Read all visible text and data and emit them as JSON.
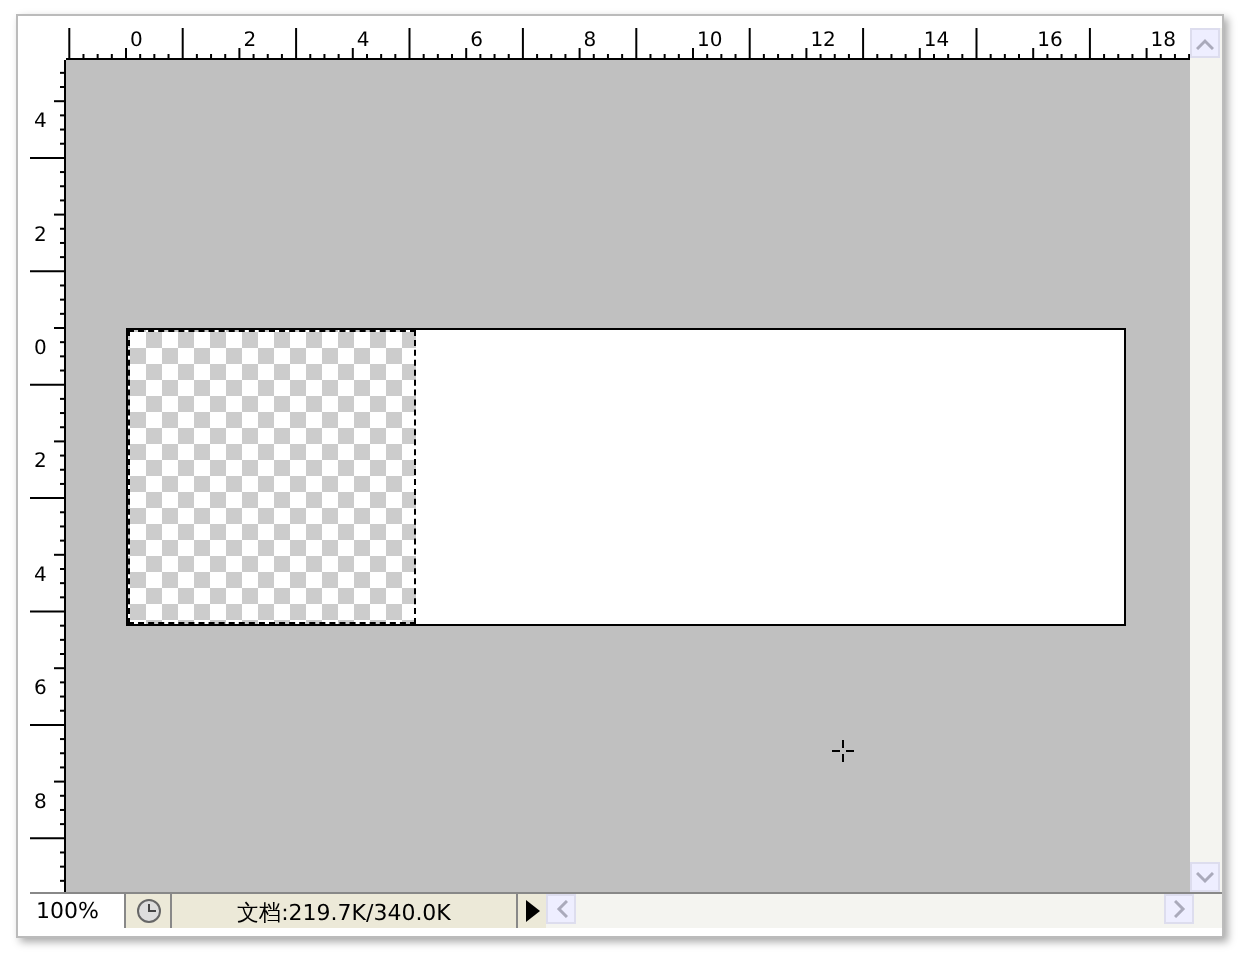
{
  "rulers": {
    "horizontal_labels": [
      "0",
      "2",
      "4",
      "6",
      "8",
      "10",
      "12",
      "14",
      "16",
      "18"
    ],
    "vertical_labels": [
      "4",
      "2",
      "0",
      "2",
      "4",
      "6",
      "8"
    ]
  },
  "status_bar": {
    "zoom": "100%",
    "doc_info": "文档:219.7K/340.0K"
  }
}
